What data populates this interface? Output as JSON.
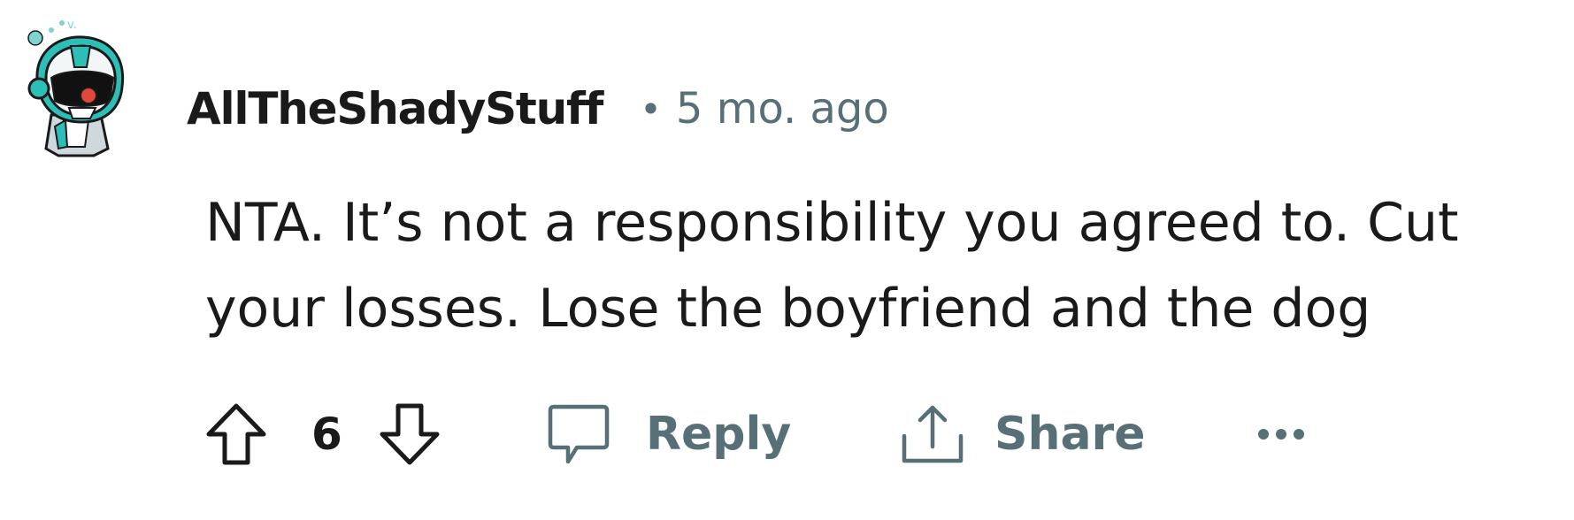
{
  "comment": {
    "author": "AllTheShadyStuff",
    "separator": "•",
    "timestamp": "5 mo. ago",
    "body": "NTA. It’s not a responsibility you agreed to. Cut your losses. Lose the boyfriend and the dog",
    "score": "6"
  },
  "actions": {
    "reply_label": "Reply",
    "share_label": "Share"
  },
  "icons": {
    "avatar": "robot-avatar-icon",
    "upvote": "arrow-up-outline-icon",
    "downvote": "arrow-down-outline-icon",
    "reply": "speech-bubble-icon",
    "share": "share-upload-icon",
    "more": "ellipsis-icon"
  },
  "colors": {
    "text": "#1a1a1b",
    "meta": "#576f76",
    "avatar_teal": "#2cbfb8"
  }
}
